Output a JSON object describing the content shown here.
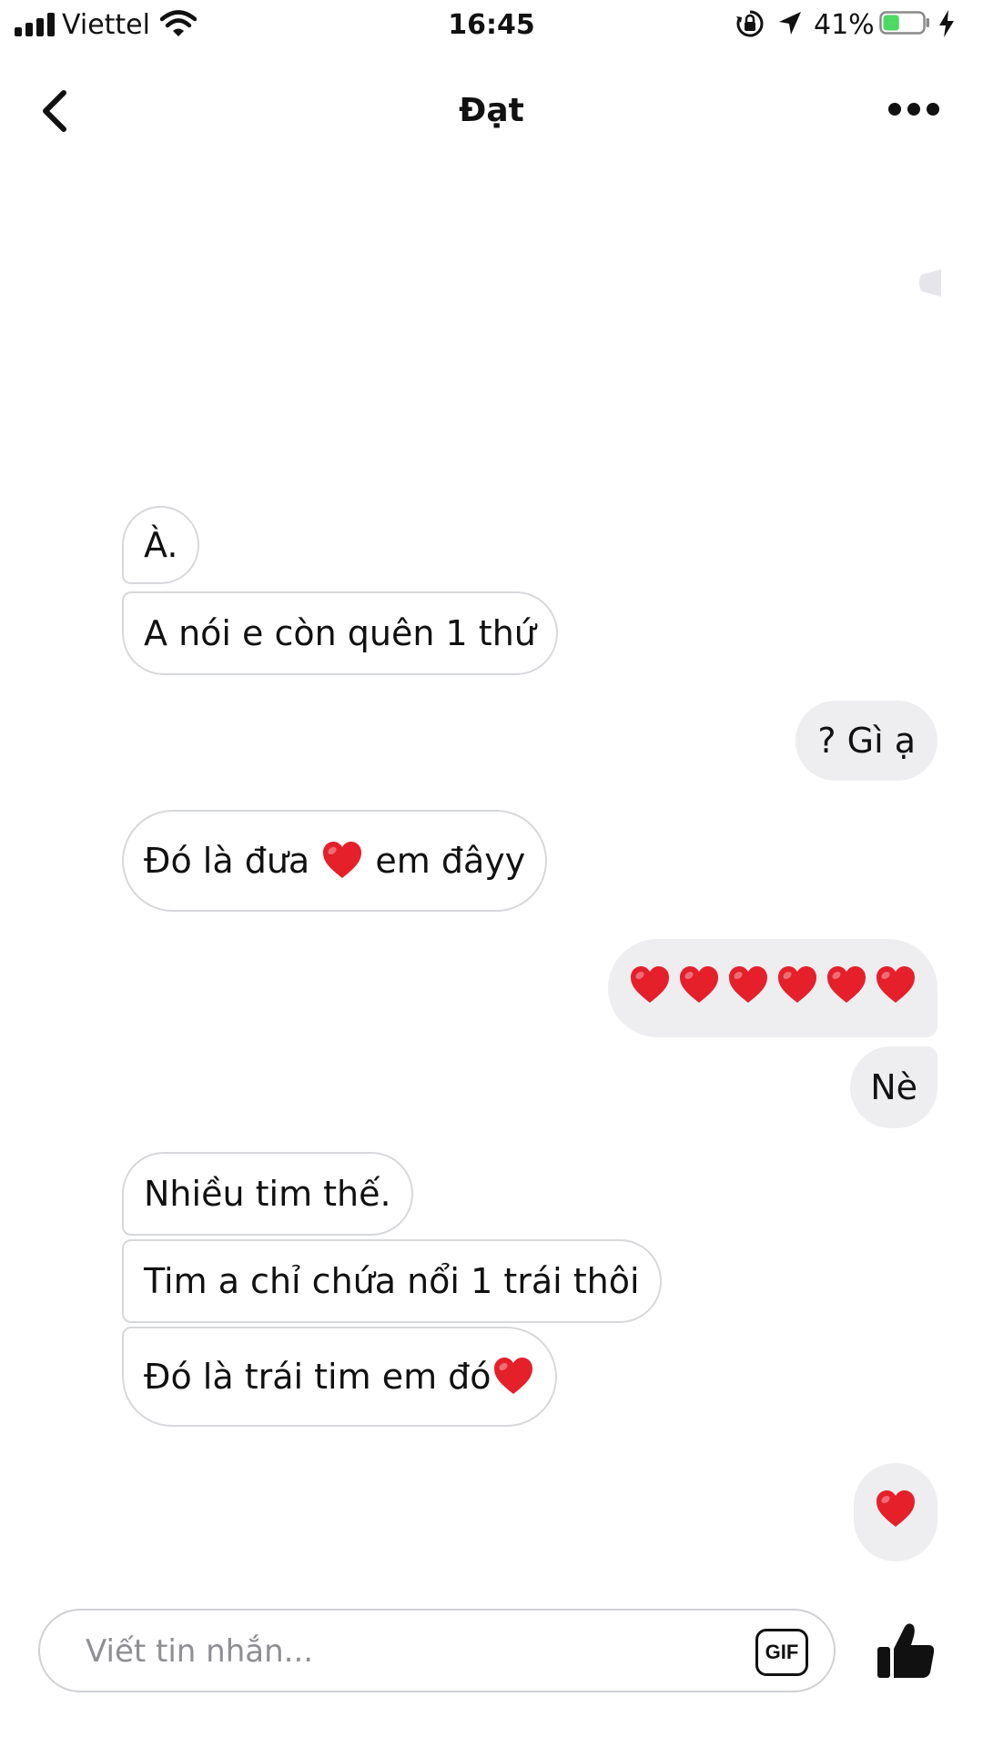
{
  "status_bar": {
    "carrier": "Viettel",
    "time": "16:45",
    "battery_percent": "41%",
    "battery_level": 0.41,
    "battery_color": "#4cd964"
  },
  "header": {
    "title": "Đạt"
  },
  "messages": {
    "m1": "À.",
    "m2": "A nói e còn quên 1 thứ",
    "m3": "? Gì ạ",
    "m4a": "Đó là đưa",
    "m4b": "em đâyy",
    "m5": "Nè",
    "m6": "Nhiều tim thế.",
    "m7": "Tim a chỉ chứa nổi 1 trái thôi",
    "m8": "Đó là trái tim em đó"
  },
  "composer": {
    "placeholder": "Viết tin nhắn...",
    "gif_label": "GIF"
  },
  "colors": {
    "heart": "#e5202b",
    "outgoing_bubble": "#eeeef1",
    "incoming_border": "#d6d8db"
  },
  "icons": [
    "signal-icon",
    "wifi-icon",
    "lock-rotation-icon",
    "location-icon",
    "battery-icon",
    "charging-icon",
    "back-chevron-icon",
    "more-dots-icon",
    "heart-icon",
    "thumbs-up-icon"
  ]
}
